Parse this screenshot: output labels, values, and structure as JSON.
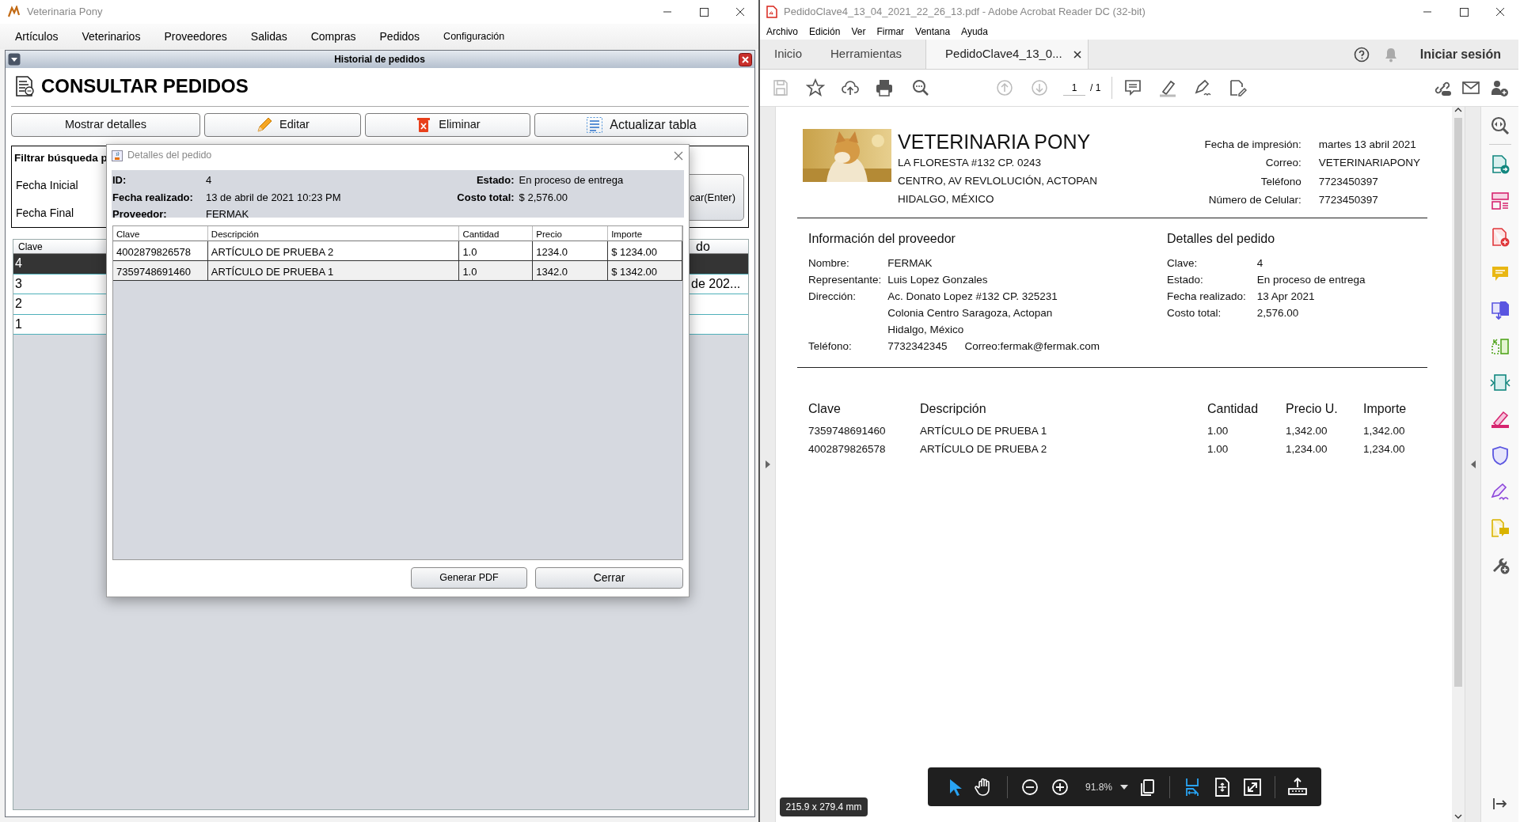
{
  "left_window": {
    "title": "Veterinaria Pony",
    "menu": [
      "Artículos",
      "Veterinarios",
      "Proveedores",
      "Salidas",
      "Compras",
      "Pedidos",
      "Configuración"
    ],
    "internal_frame": {
      "title": "Historial de pedidos",
      "heading": "CONSULTAR PEDIDOS",
      "buttons": [
        "Mostrar detalles",
        "Editar",
        "Eliminar",
        "Actualizar tabla"
      ],
      "filter": {
        "title": "Filtrar búsqueda p",
        "fields": [
          "Fecha Inicial",
          "Fecha Final"
        ],
        "search_button": "car(Enter)"
      },
      "table": {
        "columns": [
          "Clave",
          "do"
        ],
        "rows": [
          {
            "clave": "4",
            "selected": true
          },
          {
            "clave": "3",
            "last_column": "de 202...",
            "selected": false
          },
          {
            "clave": "2",
            "selected": false
          },
          {
            "clave": "1",
            "selected": false
          }
        ]
      }
    }
  },
  "dialog": {
    "title": "Detalles del pedido",
    "info_left": [
      {
        "label": "ID:",
        "value": "4"
      },
      {
        "label": "Fecha realizado:",
        "value": "13 de abril de 2021 10:23 PM"
      },
      {
        "label": "Proveedor:",
        "value": "FERMAK"
      }
    ],
    "info_right": [
      {
        "label": "Estado:",
        "value": "En proceso de entrega"
      },
      {
        "label": "Costo total:",
        "value": "$ 2,576.00"
      }
    ],
    "table": {
      "columns": [
        "Clave",
        "Descripción",
        "Cantidad",
        "Precio",
        "Importe"
      ],
      "rows": [
        [
          "4002879826578",
          "ARTÍCULO DE PRUEBA 2",
          "1.0",
          "1234.0",
          "$ 1234.00"
        ],
        [
          "7359748691460",
          "ARTÍCULO DE PRUEBA 1",
          "1.0",
          "1342.0",
          "$ 1342.00"
        ]
      ]
    },
    "buttons": [
      "Generar PDF",
      "Cerrar"
    ]
  },
  "acrobat": {
    "title": "PedidoClave4_13_04_2021_22_26_13.pdf - Adobe Acrobat Reader DC (32-bit)",
    "menu": [
      "Archivo",
      "Edición",
      "Ver",
      "Firmar",
      "Ventana",
      "Ayuda"
    ],
    "tabs": [
      {
        "label": "Inicio",
        "selected": false
      },
      {
        "label": "Herramientas",
        "selected": false
      },
      {
        "label": "PedidoClave4_13_0...",
        "selected": true
      }
    ],
    "sign_in": "Iniciar sesión",
    "page": {
      "current": "1",
      "total": "/ 1"
    },
    "document": {
      "company": {
        "name": "VETERINARIA PONY",
        "address": [
          "LA FLORESTA #132 CP. 0243",
          "CENTRO, AV REVLOLUCIÓN, ACTOPAN",
          "HIDALGO, MÉXICO"
        ]
      },
      "print_info": [
        {
          "label": "Fecha de impresión:",
          "value": "martes 13 abril 2021"
        },
        {
          "label": "Correo:",
          "value": "VETERINARIAPONY"
        },
        {
          "label": "Teléfono",
          "value": "7723450397"
        },
        {
          "label": "Número de Celular:",
          "value": "7723450397"
        }
      ],
      "supplier": {
        "title": "Información del proveedor",
        "rows": [
          {
            "label": "Nombre:",
            "lines": [
              "FERMAK"
            ]
          },
          {
            "label": "Representante:",
            "lines": [
              "Luis Lopez Gonzales"
            ]
          },
          {
            "label": "Dirección:",
            "lines": [
              "Ac. Donato Lopez #132 CP. 325231",
              "Colonia Centro Saragoza, Actopan",
              "Hidalgo, México"
            ]
          },
          {
            "label": "Teléfono:",
            "lines": [
              "7732342345"
            ],
            "extra": "Correo:fermak@fermak.com"
          }
        ]
      },
      "order": {
        "title": "Detalles del pedido",
        "rows": [
          {
            "label": "Clave:",
            "value": "4"
          },
          {
            "label": "Estado:",
            "value": "En proceso de entrega"
          },
          {
            "label": "Fecha realizado:",
            "value": "13 Apr 2021"
          },
          {
            "label": "Costo total:",
            "value": "2,576.00"
          }
        ]
      },
      "items": {
        "columns": [
          "Clave",
          "Descripción",
          "Cantidad",
          "Precio U.",
          "Importe"
        ],
        "rows": [
          [
            "7359748691460",
            "ARTÍCULO DE PRUEBA 1",
            "1.00",
            "1,342.00",
            "1,342.00"
          ],
          [
            "4002879826578",
            "ARTÍCULO DE PRUEBA 2",
            "1.00",
            "1,234.00",
            "1,234.00"
          ]
        ]
      }
    },
    "zoom_toolbar": {
      "zoom": "91.8%"
    },
    "page_size_tooltip": "215.9 x 279.4 mm"
  }
}
